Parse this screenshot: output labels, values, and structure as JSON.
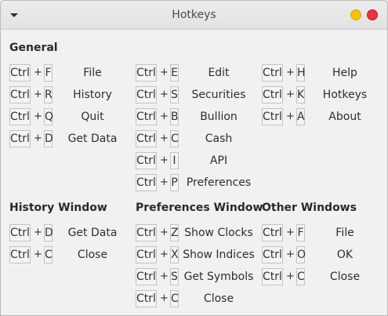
{
  "window": {
    "title": "Hotkeys"
  },
  "sections": {
    "general": {
      "heading": "General",
      "columns": [
        [
          {
            "mod": "Ctrl",
            "plus": "+",
            "key": "F",
            "action": "File"
          },
          {
            "mod": "Ctrl",
            "plus": "+",
            "key": "R",
            "action": "History"
          },
          {
            "mod": "Ctrl",
            "plus": "+",
            "key": "Q",
            "action": "Quit"
          },
          {
            "mod": "Ctrl",
            "plus": "+",
            "key": "D",
            "action": "Get Data"
          }
        ],
        [
          {
            "mod": "Ctrl",
            "plus": "+",
            "key": "E",
            "action": "Edit"
          },
          {
            "mod": "Ctrl",
            "plus": "+",
            "key": "S",
            "action": "Securities"
          },
          {
            "mod": "Ctrl",
            "plus": "+",
            "key": "B",
            "action": "Bullion"
          },
          {
            "mod": "Ctrl",
            "plus": "+",
            "key": "C",
            "action": "Cash"
          },
          {
            "mod": "Ctrl",
            "plus": "+",
            "key": "I",
            "action": "API"
          },
          {
            "mod": "Ctrl",
            "plus": "+",
            "key": "P",
            "action": "Preferences"
          }
        ],
        [
          {
            "mod": "Ctrl",
            "plus": "+",
            "key": "H",
            "action": "Help"
          },
          {
            "mod": "Ctrl",
            "plus": "+",
            "key": "K",
            "action": "Hotkeys"
          },
          {
            "mod": "Ctrl",
            "plus": "+",
            "key": "A",
            "action": "About"
          }
        ]
      ]
    },
    "history": {
      "heading": "History Window",
      "rows": [
        {
          "mod": "Ctrl",
          "plus": "+",
          "key": "D",
          "action": "Get Data"
        },
        {
          "mod": "Ctrl",
          "plus": "+",
          "key": "C",
          "action": "Close"
        }
      ]
    },
    "preferences": {
      "heading": "Preferences Window",
      "rows": [
        {
          "mod": "Ctrl",
          "plus": "+",
          "key": "Z",
          "action": "Show Clocks"
        },
        {
          "mod": "Ctrl",
          "plus": "+",
          "key": "X",
          "action": "Show Indices"
        },
        {
          "mod": "Ctrl",
          "plus": "+",
          "key": "S",
          "action": "Get Symbols"
        },
        {
          "mod": "Ctrl",
          "plus": "+",
          "key": "C",
          "action": "Close"
        }
      ]
    },
    "other": {
      "heading": "Other Windows",
      "rows": [
        {
          "mod": "Ctrl",
          "plus": "+",
          "key": "F",
          "action": "File"
        },
        {
          "mod": "Ctrl",
          "plus": "+",
          "key": "O",
          "action": "OK"
        },
        {
          "mod": "Ctrl",
          "plus": "+",
          "key": "C",
          "action": "Close"
        }
      ]
    }
  }
}
